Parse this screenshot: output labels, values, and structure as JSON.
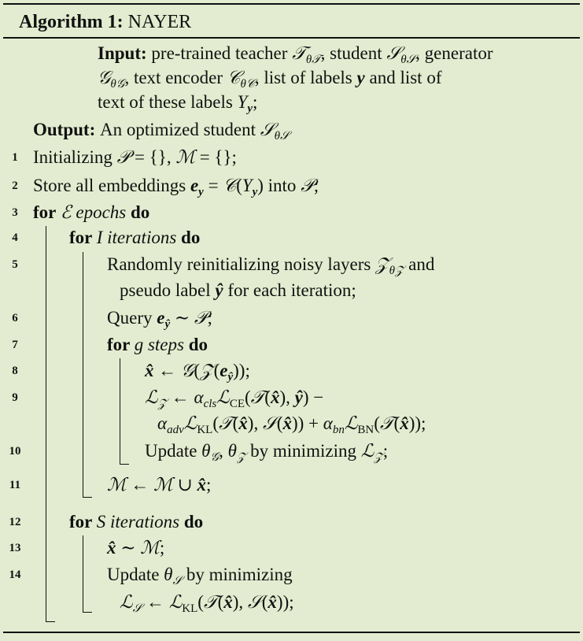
{
  "algorithm": {
    "title": [
      {
        "t": "Algorithm 1: ",
        "f": "b"
      },
      {
        "t": "NAYER"
      }
    ],
    "lines": [
      {
        "num": "",
        "seg": [
          {
            "t": "Input: ",
            "f": "b"
          },
          {
            "t": "pre-trained teacher "
          },
          {
            "t": "𝒯",
            "f": "m"
          },
          {
            "t": "θ𝒯",
            "f": "sub"
          },
          {
            "t": ", student "
          },
          {
            "t": "𝒮",
            "f": "m"
          },
          {
            "t": "θ𝒮",
            "f": "sub"
          },
          {
            "t": ", generator"
          }
        ]
      },
      {
        "num": "",
        "seg": [
          {
            "t": "𝒢",
            "f": "m"
          },
          {
            "t": "θ𝒢",
            "f": "sub"
          },
          {
            "t": ", text encoder "
          },
          {
            "t": "𝒞",
            "f": "m"
          },
          {
            "t": "θ𝒞",
            "f": "sub"
          },
          {
            "t": ", list of labels "
          },
          {
            "t": "y",
            "f": "mb"
          },
          {
            "t": " and list of"
          }
        ]
      },
      {
        "num": "",
        "seg": [
          {
            "t": "text of these labels "
          },
          {
            "t": "Y",
            "f": "m"
          },
          {
            "t": "y",
            "f": "subb"
          },
          {
            "t": ";"
          }
        ]
      },
      {
        "num": "",
        "seg": [
          {
            "t": "Output: ",
            "f": "b"
          },
          {
            "t": "An optimized student "
          },
          {
            "t": "𝒮",
            "f": "m"
          },
          {
            "t": "θ𝒮",
            "f": "sub"
          }
        ]
      },
      {
        "num": "1",
        "seg": [
          {
            "t": "Initializing "
          },
          {
            "t": "𝒫",
            "f": "m"
          },
          {
            "t": " = {}, "
          },
          {
            "t": "ℳ",
            "f": "m"
          },
          {
            "t": " = {};"
          }
        ]
      },
      {
        "num": "2",
        "seg": [
          {
            "t": "Store all embeddings "
          },
          {
            "t": "e",
            "f": "mb"
          },
          {
            "t": "y",
            "f": "subb"
          },
          {
            "t": " = "
          },
          {
            "t": "𝒞",
            "f": "m"
          },
          {
            "t": "("
          },
          {
            "t": "Y",
            "f": "m"
          },
          {
            "t": "y",
            "f": "subb"
          },
          {
            "t": ") into "
          },
          {
            "t": "𝒫",
            "f": "m"
          },
          {
            "t": ";"
          }
        ]
      },
      {
        "num": "3",
        "seg": [
          {
            "t": "for ",
            "f": "b"
          },
          {
            "t": "ℰ",
            "f": "m"
          },
          {
            "t": " epochs",
            "f": "i"
          },
          {
            "t": " do",
            "f": "b"
          }
        ]
      },
      {
        "num": "4",
        "seg": [
          {
            "t": "for ",
            "f": "b"
          },
          {
            "t": "I iterations",
            "f": "i"
          },
          {
            "t": " do",
            "f": "b"
          }
        ]
      },
      {
        "num": "5",
        "seg": [
          {
            "t": "Randomly reinitializing noisy layers "
          },
          {
            "t": "𝒵",
            "f": "m"
          },
          {
            "t": "θ𝒵",
            "f": "sub"
          },
          {
            "t": " and"
          }
        ]
      },
      {
        "num": "",
        "seg": [
          {
            "t": "pseudo label "
          },
          {
            "t": "ŷ",
            "f": "mb"
          },
          {
            "t": " for each iteration;"
          }
        ]
      },
      {
        "num": "6",
        "seg": [
          {
            "t": "Query "
          },
          {
            "t": "e",
            "f": "mb"
          },
          {
            "t": "ŷ",
            "f": "subb"
          },
          {
            "t": " ∼ "
          },
          {
            "t": "𝒫",
            "f": "m"
          },
          {
            "t": ";"
          }
        ]
      },
      {
        "num": "7",
        "seg": [
          {
            "t": "for ",
            "f": "b"
          },
          {
            "t": "g steps",
            "f": "i"
          },
          {
            "t": " do",
            "f": "b"
          }
        ]
      },
      {
        "num": "8",
        "seg": [
          {
            "t": "x̂",
            "f": "mb"
          },
          {
            "t": " ← "
          },
          {
            "t": "𝒢",
            "f": "m"
          },
          {
            "t": "("
          },
          {
            "t": "𝒵",
            "f": "m"
          },
          {
            "t": "("
          },
          {
            "t": "e",
            "f": "mb"
          },
          {
            "t": "ŷ",
            "f": "subb"
          },
          {
            "t": "));"
          }
        ]
      },
      {
        "num": "9",
        "seg": [
          {
            "t": "ℒ",
            "f": "m"
          },
          {
            "t": "𝒵",
            "f": "sub"
          },
          {
            "t": " ← "
          },
          {
            "t": "α",
            "f": "m"
          },
          {
            "t": "cls",
            "f": "sub"
          },
          {
            "t": "ℒ",
            "f": "m"
          },
          {
            "t": "CE",
            "f": "subr"
          },
          {
            "t": "("
          },
          {
            "t": "𝒯",
            "f": "m"
          },
          {
            "t": "("
          },
          {
            "t": "x̂",
            "f": "mb"
          },
          {
            "t": "), "
          },
          {
            "t": "ŷ",
            "f": "mb"
          },
          {
            "t": ") −"
          }
        ]
      },
      {
        "num": "",
        "seg": [
          {
            "t": "α",
            "f": "m"
          },
          {
            "t": "adv",
            "f": "sub"
          },
          {
            "t": "ℒ",
            "f": "m"
          },
          {
            "t": "KL",
            "f": "subr"
          },
          {
            "t": "("
          },
          {
            "t": "𝒯",
            "f": "m"
          },
          {
            "t": "("
          },
          {
            "t": "x̂",
            "f": "mb"
          },
          {
            "t": "), "
          },
          {
            "t": "𝒮",
            "f": "m"
          },
          {
            "t": "("
          },
          {
            "t": "x̂",
            "f": "mb"
          },
          {
            "t": ")) + "
          },
          {
            "t": "α",
            "f": "m"
          },
          {
            "t": "bn",
            "f": "sub"
          },
          {
            "t": "ℒ",
            "f": "m"
          },
          {
            "t": "BN",
            "f": "subr"
          },
          {
            "t": "("
          },
          {
            "t": "𝒯",
            "f": "m"
          },
          {
            "t": "("
          },
          {
            "t": "x̂",
            "f": "mb"
          },
          {
            "t": "));"
          }
        ]
      },
      {
        "num": "10",
        "seg": [
          {
            "t": "Update "
          },
          {
            "t": "θ",
            "f": "m"
          },
          {
            "t": "𝒢",
            "f": "sub"
          },
          {
            "t": ", "
          },
          {
            "t": "θ",
            "f": "m"
          },
          {
            "t": "𝒵",
            "f": "sub"
          },
          {
            "t": " by minimizing "
          },
          {
            "t": "ℒ",
            "f": "m"
          },
          {
            "t": "𝒵",
            "f": "sub"
          },
          {
            "t": ";"
          }
        ]
      },
      {
        "num": "11",
        "seg": [
          {
            "t": "ℳ",
            "f": "m"
          },
          {
            "t": " ← "
          },
          {
            "t": "ℳ",
            "f": "m"
          },
          {
            "t": " ∪ "
          },
          {
            "t": "x̂",
            "f": "mb"
          },
          {
            "t": ";"
          }
        ]
      },
      {
        "num": "12",
        "seg": [
          {
            "t": "for ",
            "f": "b"
          },
          {
            "t": "S iterations",
            "f": "i"
          },
          {
            "t": " do",
            "f": "b"
          }
        ]
      },
      {
        "num": "13",
        "seg": [
          {
            "t": "x̂",
            "f": "mb"
          },
          {
            "t": " ∼ "
          },
          {
            "t": "ℳ",
            "f": "m"
          },
          {
            "t": ";"
          }
        ]
      },
      {
        "num": "14",
        "seg": [
          {
            "t": "Update "
          },
          {
            "t": "θ",
            "f": "m"
          },
          {
            "t": "𝒮",
            "f": "sub"
          },
          {
            "t": " by minimizing"
          }
        ]
      },
      {
        "num": "",
        "seg": [
          {
            "t": "ℒ",
            "f": "m"
          },
          {
            "t": "𝒮",
            "f": "sub"
          },
          {
            "t": " ← "
          },
          {
            "t": "ℒ",
            "f": "m"
          },
          {
            "t": "KL",
            "f": "subr"
          },
          {
            "t": "("
          },
          {
            "t": "𝒯",
            "f": "m"
          },
          {
            "t": "("
          },
          {
            "t": "x̂",
            "f": "mb"
          },
          {
            "t": "), "
          },
          {
            "t": "𝒮",
            "f": "m"
          },
          {
            "t": "("
          },
          {
            "t": "x̂",
            "f": "mb"
          },
          {
            "t": "));"
          }
        ]
      }
    ]
  }
}
